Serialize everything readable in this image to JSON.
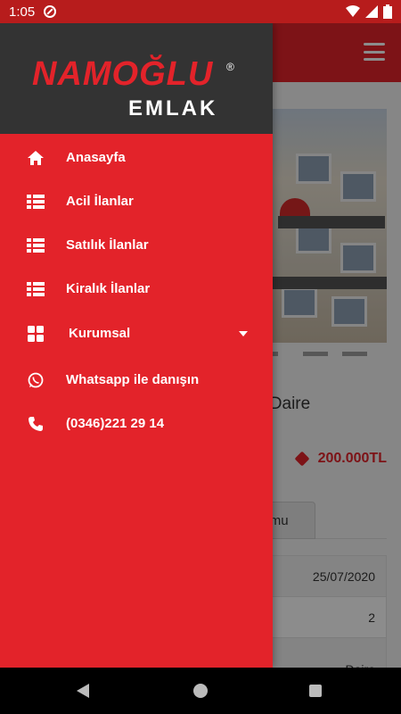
{
  "status_bar": {
    "time": "1:05"
  },
  "drawer": {
    "logo": {
      "brand": "NAMOĞLU",
      "registered": "®",
      "sub": "EMLAK"
    },
    "items": [
      {
        "label": "Anasayfa",
        "icon": "home-icon"
      },
      {
        "label": "Acil İlanlar",
        "icon": "list-icon"
      },
      {
        "label": "Satılık İlanlar",
        "icon": "list-icon"
      },
      {
        "label": "Kiralık İlanlar",
        "icon": "list-icon"
      },
      {
        "label": "Kurumsal",
        "icon": "grid-icon",
        "expandable": true
      },
      {
        "label": "Whatsapp ile danışın",
        "icon": "whatsapp-icon"
      },
      {
        "label": "(0346)221 29 14",
        "icon": "phone-icon"
      }
    ]
  },
  "page": {
    "listing_title_visible": "k Daire",
    "price": "200.000TL",
    "tab_label_visible": "umu",
    "table_rows": [
      "25/07/2020",
      "2",
      "Daire"
    ]
  },
  "colors": {
    "primary": "#e3232a",
    "header_dark": "#333333",
    "status_bar": "#b71c1c"
  }
}
